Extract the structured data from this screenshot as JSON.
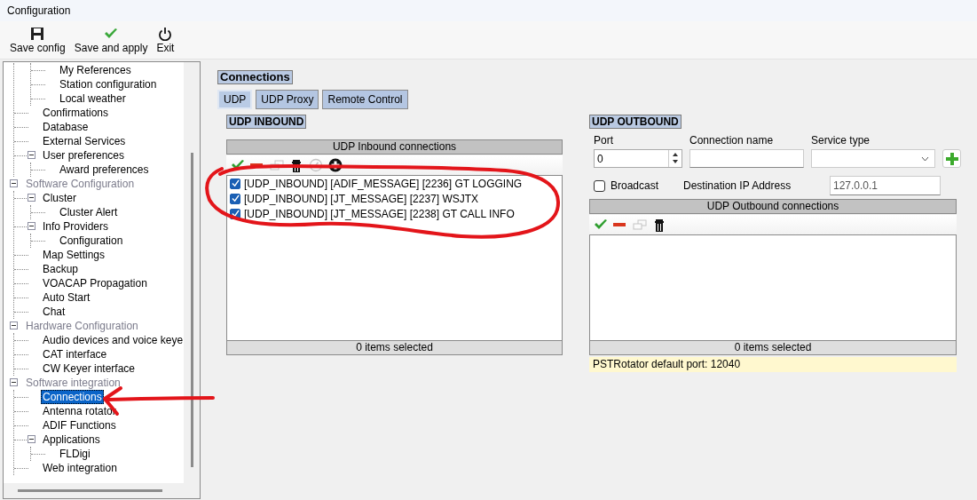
{
  "window": {
    "title": "Configuration"
  },
  "toolbar": [
    {
      "label": "Save config",
      "kind": "save"
    },
    {
      "label": "Save and apply",
      "kind": "apply"
    },
    {
      "label": "Exit",
      "kind": "exit"
    }
  ],
  "tree": [
    {
      "expanded": true,
      "children": [
        {
          "expanded": true,
          "children": [
            {
              "label": "My References",
              "selected": false
            },
            {
              "label": "Station configuration",
              "selected": false
            },
            {
              "label": "Local weather",
              "selected": false
            }
          ]
        },
        {
          "label": "Confirmations",
          "selected": false
        },
        {
          "label": "Database",
          "selected": false
        },
        {
          "label": "External Services",
          "selected": false
        },
        {
          "label": "User preferences",
          "selected": false,
          "expanded": true,
          "children": [
            {
              "label": "Award preferences",
              "selected": false
            }
          ]
        }
      ]
    },
    {
      "label": "Software Configuration",
      "selected": false,
      "expanded": true,
      "children": [
        {
          "label": "Cluster",
          "selected": false,
          "expanded": true,
          "children": [
            {
              "label": "Cluster Alert",
              "selected": false
            }
          ]
        },
        {
          "label": "Info Providers",
          "selected": false,
          "expanded": true,
          "children": [
            {
              "label": "Configuration",
              "selected": false
            }
          ]
        },
        {
          "label": "Map Settings",
          "selected": false
        },
        {
          "label": "Backup",
          "selected": false
        },
        {
          "label": "VOACAP Propagation",
          "selected": false
        },
        {
          "label": "Auto Start",
          "selected": false
        },
        {
          "label": "Chat",
          "selected": false
        }
      ]
    },
    {
      "label": "Hardware Configuration",
      "selected": false,
      "expanded": true,
      "children": [
        {
          "label": "Audio devices and voice keye",
          "selected": false
        },
        {
          "label": "CAT interface",
          "selected": false
        },
        {
          "label": "CW Keyer interface",
          "selected": false
        }
      ]
    },
    {
      "label": "Software integration",
      "selected": false,
      "expanded": true,
      "children": [
        {
          "label": "Connections",
          "selected": true
        },
        {
          "label": "Antenna rotator",
          "selected": false
        },
        {
          "label": "ADIF Functions",
          "selected": false
        },
        {
          "label": "Applications",
          "selected": false,
          "expanded": true,
          "children": [
            {
              "label": "FLDigi",
              "selected": false
            }
          ]
        },
        {
          "label": "Web integration",
          "selected": false
        }
      ]
    }
  ],
  "section_title": "Connections",
  "tabs": [
    {
      "label": "UDP",
      "selected": true
    },
    {
      "label": "UDP Proxy",
      "selected": false
    },
    {
      "label": "Remote Control",
      "selected": false
    }
  ],
  "inbound": {
    "title": "UDP INBOUND",
    "list_header": "UDP Inbound connections",
    "tools": [
      {
        "kind": "check",
        "disabled": false
      },
      {
        "kind": "remove",
        "disabled": false
      },
      {
        "kind": "duplicate",
        "disabled": true
      },
      {
        "kind": "delete",
        "disabled": false
      },
      {
        "kind": "edit",
        "disabled": true
      },
      {
        "kind": "add",
        "disabled": false
      }
    ],
    "items": [
      {
        "label": "[UDP_INBOUND] [ADIF_MESSAGE] [2236] GT LOGGING",
        "checked": true
      },
      {
        "label": "[UDP_INBOUND] [JT_MESSAGE] [2237] WSJTX",
        "checked": true
      },
      {
        "label": "[UDP_INBOUND] [JT_MESSAGE] [2238] GT CALL INFO",
        "checked": true
      }
    ],
    "footer": "0 items selected"
  },
  "outbound": {
    "title": "UDP OUTBOUND",
    "port": {
      "label": "Port",
      "value": "0"
    },
    "connection_name": {
      "label": "Connection name"
    },
    "service_type": {
      "label": "Service type"
    },
    "broadcast": {
      "label": "Broadcast",
      "checked": false
    },
    "destination": {
      "label": "Destination IP Address",
      "value": "127.0.0.1"
    },
    "list_header": "UDP Outbound connections",
    "tools": [
      {
        "kind": "check",
        "disabled": false
      },
      {
        "kind": "remove",
        "disabled": false
      },
      {
        "kind": "duplicate",
        "disabled": true
      },
      {
        "kind": "delete",
        "disabled": false
      }
    ],
    "footer": "0 items selected",
    "note": "PSTRotator default port: 12040"
  }
}
